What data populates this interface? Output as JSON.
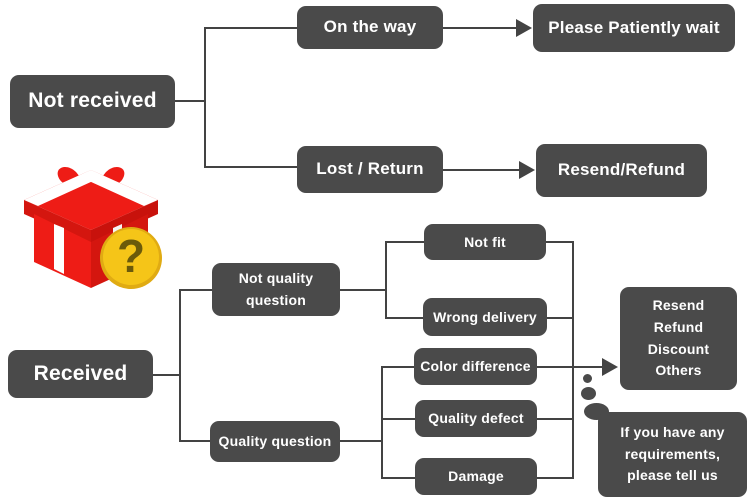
{
  "diagram": {
    "title": "Order issue handling flowchart",
    "colors": {
      "node_bg": "#4a4a4a",
      "node_text": "#ffffff",
      "connector": "#434343",
      "background": "#ffffff",
      "gift_red": "#ee1c16",
      "gift_badge": "#f5c518"
    },
    "icon": {
      "name": "gift-box-question-icon",
      "label": "Gift box with question mark"
    },
    "nodes": {
      "not_received": "Not received",
      "on_the_way": "On the way",
      "please_wait": "Please Patiently wait",
      "lost_return": "Lost / Return",
      "resend_refund": "Resend/Refund",
      "received": "Received",
      "not_quality_question_line1": "Not quality",
      "not_quality_question_line2": "question",
      "quality_question": "Quality question",
      "not_fit": "Not fit",
      "wrong_delivery": "Wrong delivery",
      "color_difference": "Color difference",
      "quality_defect": "Quality defect",
      "damage": "Damage",
      "outcomes": [
        "Resend",
        "Refund",
        "Discount",
        "Others"
      ],
      "message_line1": "If you have any",
      "message_line2": "requirements,",
      "message_line3": "please tell us"
    }
  }
}
